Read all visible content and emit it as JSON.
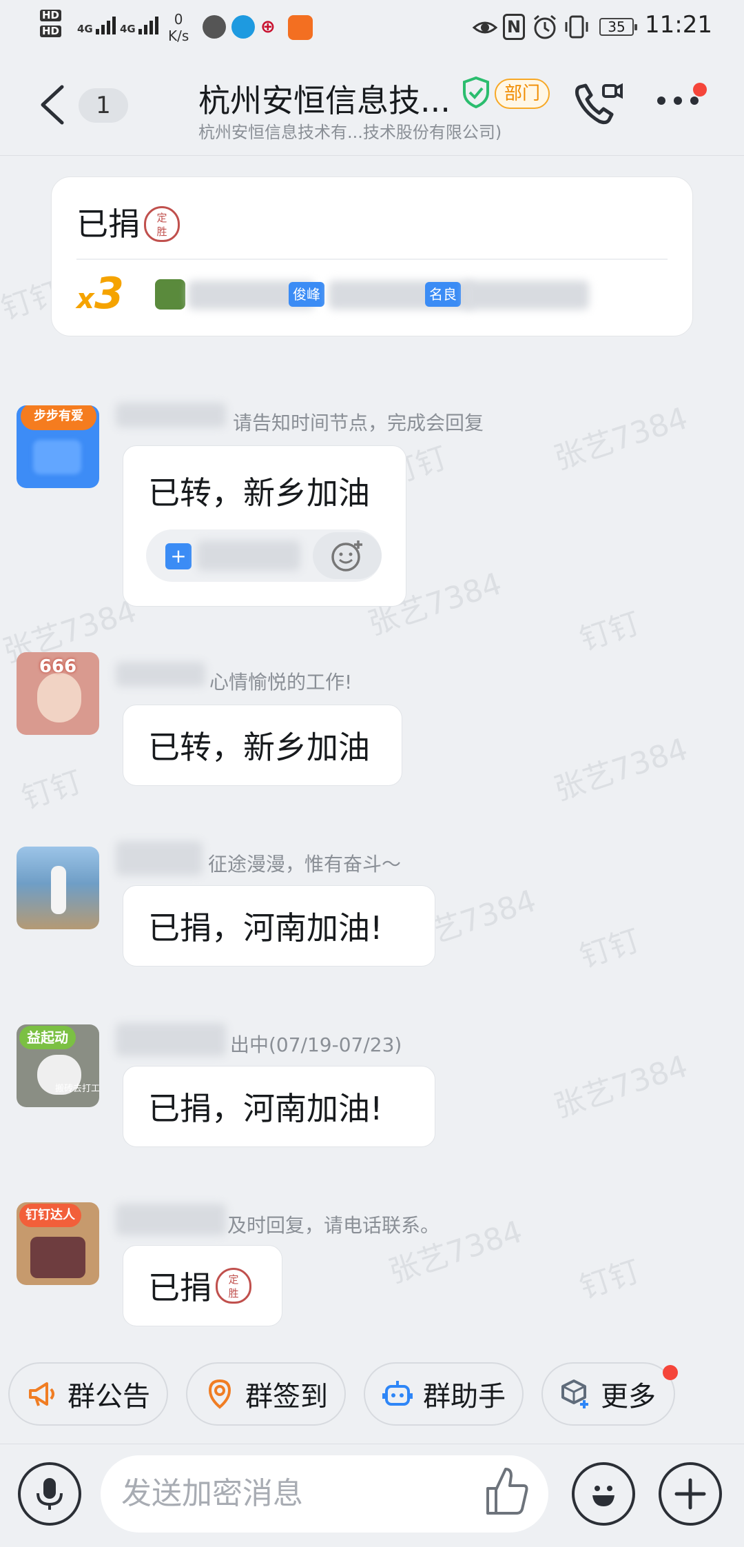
{
  "status_bar": {
    "hd1": "HD",
    "hd2": "HD",
    "net1": "4G",
    "net2": "4G",
    "speed_value": "0",
    "speed_unit": "K/s",
    "nfc": "N",
    "battery": "35",
    "time": "11:21"
  },
  "header": {
    "unread_count": "1",
    "title": "杭州安恒信息技...",
    "badge": "部门",
    "subtitle": "杭州安恒信息技术有...技术股份有限公司)"
  },
  "pinned": {
    "text": "已捐",
    "seal_top": "定",
    "seal_bottom": "胜",
    "x": "x",
    "count": "3",
    "tag1": "俊峰",
    "tag2": "名良"
  },
  "messages": [
    {
      "avatar_caption": "步步有爱",
      "note": "请告知时间节点，完成会回复",
      "text": "已转，新乡加油"
    },
    {
      "avatar_caption": "666",
      "note": "心情愉悦的工作!",
      "text": "已转，新乡加油"
    },
    {
      "avatar_caption": "",
      "note": "征途漫漫，惟有奋斗～",
      "text": "已捐，河南加油!"
    },
    {
      "avatar_caption": "益起动",
      "avatar_sub": "搬砖去打工",
      "note": "出中(07/19-07/23)",
      "text": "已捐，河南加油!"
    },
    {
      "avatar_caption": "钉钉达人",
      "note": "及时回复，请电话联系。",
      "text": "已捐"
    }
  ],
  "watermarks": [
    "张艺7384",
    "钉钉"
  ],
  "quick_actions": [
    {
      "label": "群公告",
      "icon": "megaphone-icon",
      "color": "#f07d23"
    },
    {
      "label": "群签到",
      "icon": "location-pin-icon",
      "color": "#f07d23"
    },
    {
      "label": "群助手",
      "icon": "robot-icon",
      "color": "#2e86f7"
    },
    {
      "label": "更多",
      "icon": "cube-add-icon",
      "color": "#2e86f7"
    }
  ],
  "input": {
    "placeholder": "发送加密消息"
  },
  "colors": {
    "background": "#eef0f3",
    "accent_blue": "#3b8cf5",
    "accent_orange": "#f5a300",
    "alert_red": "#f5453a"
  }
}
